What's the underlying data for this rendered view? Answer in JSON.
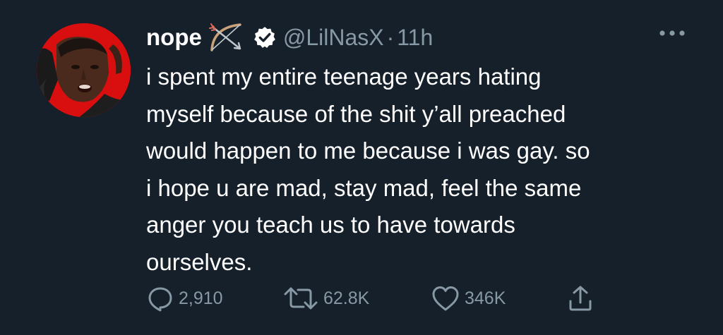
{
  "user": {
    "display_name": "nope",
    "name_emoji": "bow-and-arrow-icon",
    "verified_badge": "verified-icon",
    "handle": "@LilNasX",
    "separator": "·",
    "time": "11h"
  },
  "tweet": {
    "text": "i spent my entire teenage years hating\nmyself because of the shit y’all preached\nwould happen to me because i was gay. so\ni hope u are mad, stay mad, feel the same\nanger you teach us to have towards\nourselves."
  },
  "actions": {
    "reply_count": "2,910",
    "retweet_count": "62.8K",
    "like_count": "346K"
  },
  "colors": {
    "background": "#15202b",
    "text_primary": "#ffffff",
    "text_secondary": "#8899a6",
    "avatar_bg": "#d90f0f"
  },
  "icons": {
    "more": "more-horizontal-icon",
    "reply": "reply-icon",
    "retweet": "retweet-icon",
    "like": "heart-icon",
    "share": "share-icon"
  }
}
